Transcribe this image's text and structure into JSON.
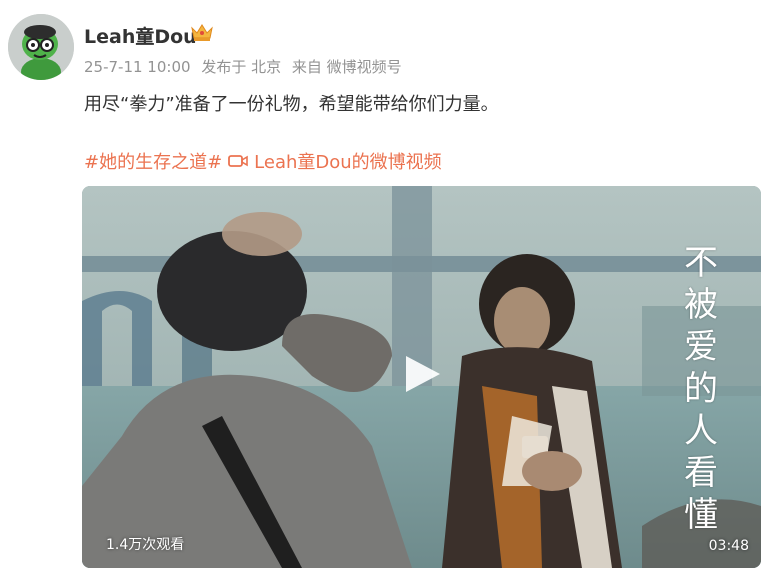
{
  "user": {
    "name": "Leah童Dou",
    "badge_icon": "crown-icon",
    "avatar_icon": "cartoon-avatar-icon"
  },
  "meta": {
    "time": "25-7-11 10:00",
    "location": "发布于 北京",
    "source": "来自 微博视频号"
  },
  "post": {
    "text": "用尽“拳力”准备了一份礼物，希望能带给你们力量。"
  },
  "tags": {
    "topic": "#她的生存之道#",
    "video_link": "Leah童Dou的微博视频",
    "video_link_icon": "video-camera-icon"
  },
  "video": {
    "views": "1.4万次观看",
    "duration": "03:48",
    "subtitle_chars": [
      "不",
      "被",
      "爱",
      "的",
      "人",
      "看",
      "懂"
    ],
    "play_icon": "play-icon"
  },
  "colors": {
    "link": "#eb7350",
    "meta": "#939393",
    "text": "#333333"
  }
}
